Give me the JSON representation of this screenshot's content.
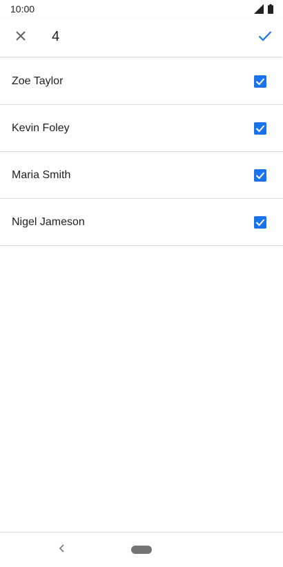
{
  "status_bar": {
    "time": "10:00",
    "icons": [
      "signal-icon",
      "battery-icon"
    ]
  },
  "app_bar": {
    "close_icon": "close-icon",
    "selected_count": "4",
    "confirm_icon": "check-icon",
    "accent_color": "#1a73e8"
  },
  "contacts": [
    {
      "name": "Zoe Taylor",
      "checked": true
    },
    {
      "name": "Kevin Foley",
      "checked": true
    },
    {
      "name": "Maria Smith",
      "checked": true
    },
    {
      "name": "Nigel Jameson",
      "checked": true
    }
  ],
  "nav_bar": {
    "back_icon": "back-chevron-icon",
    "home_icon": "home-pill-icon"
  }
}
